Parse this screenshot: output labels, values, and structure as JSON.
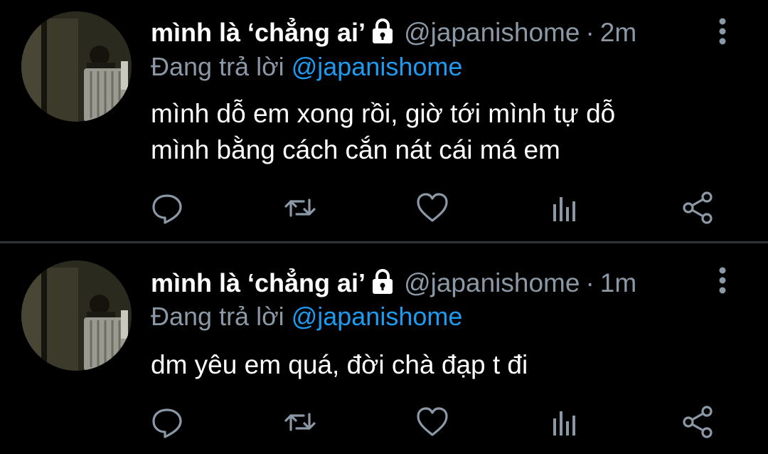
{
  "colors": {
    "background": "#000000",
    "name": "#ffffff",
    "secondary": "#8b98a5",
    "mention": "#1d9bf0",
    "divider": "#2f3336"
  },
  "tweets": [
    {
      "display_name": "mình là ‘chẳng ai’",
      "handle": "@japanishome",
      "separator": "·",
      "time": "2m",
      "replying_prefix": "Đang trả lời",
      "replying_to": "@japanishome",
      "text": "mình dỗ em xong rồi, giờ tới mình tự dỗ\nmình bằng cách cắn nát cái má em",
      "icons": [
        "avatar",
        "lock-icon",
        "more-vertical-icon",
        "reply-icon",
        "retweet-icon",
        "like-icon",
        "analytics-icon",
        "share-icon"
      ]
    },
    {
      "display_name": "mình là ‘chẳng ai’",
      "handle": "@japanishome",
      "separator": "·",
      "time": "1m",
      "replying_prefix": "Đang trả lời",
      "replying_to": "@japanishome",
      "text": "dm yêu em quá, đời chà đạp t đi",
      "icons": [
        "avatar",
        "lock-icon",
        "more-vertical-icon",
        "reply-icon",
        "retweet-icon",
        "like-icon",
        "analytics-icon",
        "share-icon"
      ]
    }
  ]
}
